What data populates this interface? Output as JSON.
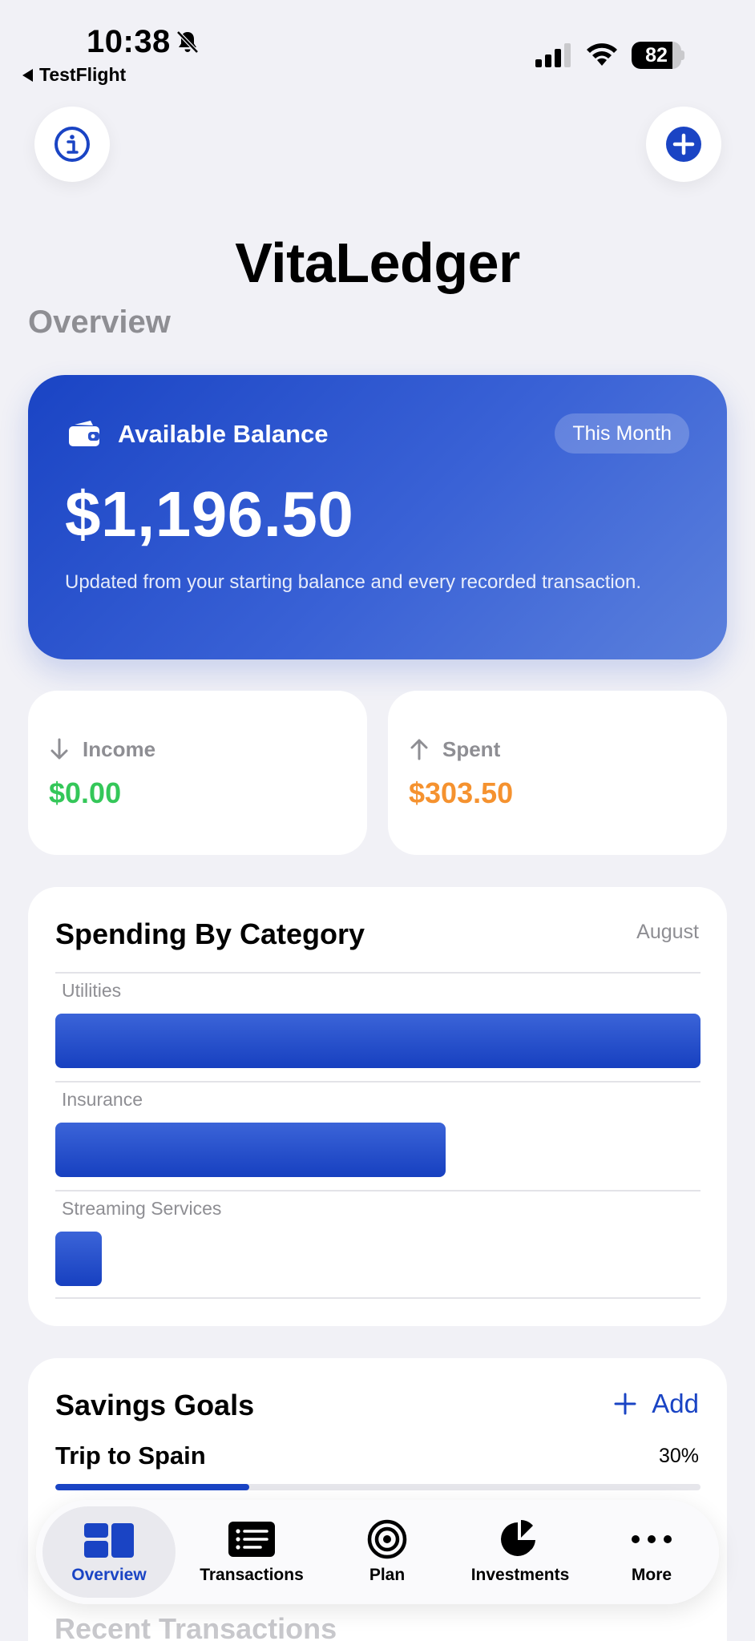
{
  "status_bar": {
    "time": "10:38",
    "back_app": "TestFlight",
    "battery": "82",
    "battery_level": 0.82
  },
  "app": {
    "title": "VitaLedger",
    "section": "Overview"
  },
  "balance": {
    "label": "Available Balance",
    "period": "This Month",
    "amount": "$1,196.50",
    "note": "Updated from your starting balance and every recorded transaction."
  },
  "stats": {
    "income": {
      "label": "Income",
      "value": "$0.00"
    },
    "spent": {
      "label": "Spent",
      "value": "$303.50"
    }
  },
  "spending": {
    "title": "Spending By Category",
    "month": "August",
    "categories": [
      {
        "name": "Utilities",
        "share": 1.0
      },
      {
        "name": "Insurance",
        "share": 0.605
      },
      {
        "name": "Streaming Services",
        "share": 0.072
      }
    ]
  },
  "savings": {
    "title": "Savings Goals",
    "add_label": "Add",
    "goals": [
      {
        "name": "Trip to Spain",
        "percent": "30%",
        "progress": 0.3
      }
    ]
  },
  "recent": {
    "title": "Recent Transactions"
  },
  "tabs": [
    {
      "label": "Overview",
      "icon": "overview-icon",
      "active": true
    },
    {
      "label": "Transactions",
      "icon": "list-icon",
      "active": false
    },
    {
      "label": "Plan",
      "icon": "target-icon",
      "active": false
    },
    {
      "label": "Investments",
      "icon": "pie-chart-icon",
      "active": false
    },
    {
      "label": "More",
      "icon": "ellipsis-icon",
      "active": false
    }
  ],
  "colors": {
    "accent": "#1a44c4",
    "income": "#34c759",
    "spent": "#f5922f",
    "background": "#f1f1f6"
  }
}
